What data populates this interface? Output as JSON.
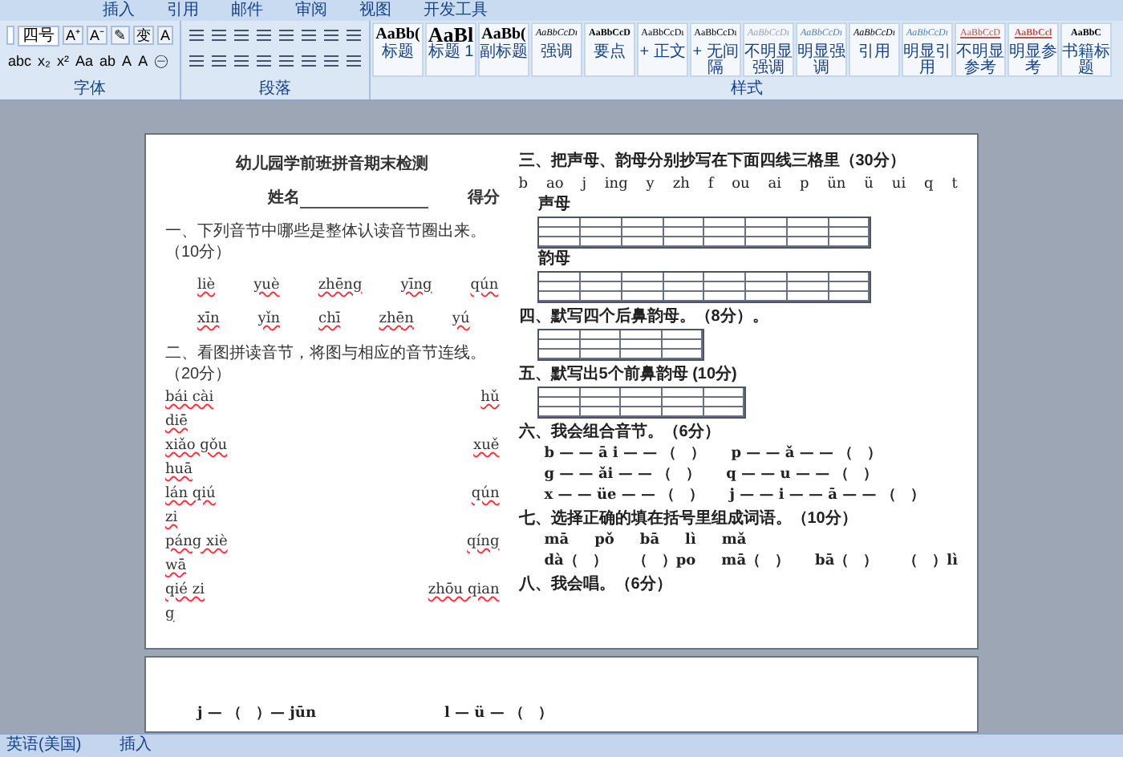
{
  "menu_tabs": [
    "插入",
    "引用",
    "邮件",
    "审阅",
    "视图",
    "开发工具"
  ],
  "ribbon": {
    "font_group": {
      "label": "字体",
      "font_size": "四号",
      "row1": [
        "A⁺",
        "A⁻",
        "✎",
        "变",
        "A"
      ],
      "row2": [
        "abc",
        "x₂",
        "x²",
        "Aa",
        "ab",
        "A",
        "A",
        "㊀"
      ]
    },
    "paragraph_group": {
      "label": "段落"
    },
    "styles_group": {
      "label": "样式",
      "styles": [
        {
          "sample": "AaBb(",
          "name": "标题",
          "kind": "heading"
        },
        {
          "sample": "AaBl",
          "name": "标题 1",
          "kind": "big"
        },
        {
          "sample": "AaBb(",
          "name": "副标题",
          "kind": "heading"
        },
        {
          "sample": "AaBbCcDı",
          "name": "强调",
          "kind": "italic"
        },
        {
          "sample": "AaBbCcD",
          "name": "要点",
          "kind": "bold"
        },
        {
          "sample": "AaBbCcDı",
          "name": "+ 正文",
          "kind": "normal"
        },
        {
          "sample": "AaBbCcDı",
          "name": "+ 无间隔",
          "kind": "normal"
        },
        {
          "sample": "AaBbCcDı",
          "name": "不明显强调",
          "kind": "faint"
        },
        {
          "sample": "AaBbCcDı",
          "name": "明显强调",
          "kind": "blue"
        },
        {
          "sample": "AaBbCcDı",
          "name": "引用",
          "kind": "italic"
        },
        {
          "sample": "AaBbCcDı",
          "name": "明显引用",
          "kind": "blue"
        },
        {
          "sample": "AaBbCcD",
          "name": "不明显参考",
          "kind": "red"
        },
        {
          "sample": "AaBbCcl",
          "name": "明显参考",
          "kind": "redbold"
        },
        {
          "sample": "AaBbC",
          "name": "书籍标题",
          "kind": "bold"
        }
      ]
    }
  },
  "page_1": {
    "title": "幼儿园学前班拼音期末检测",
    "name_label": "姓名",
    "score_label": "得分",
    "left": [
      {
        "kind": "heading",
        "text": "一、下列音节中哪些是整体认读音节圈出来。（10分）"
      },
      {
        "kind": "syllables",
        "items": [
          "liè",
          "yuè",
          "zhēng",
          "yīng",
          "qún"
        ]
      },
      {
        "kind": "syllables",
        "items": [
          "xīn",
          "yǐn",
          "chī",
          "zhēn",
          "yú"
        ]
      },
      {
        "kind": "heading",
        "text": "二、看图拼读音节，将图与相应的音节连线。（20分）"
      },
      {
        "kind": "pair",
        "left": "bái cài",
        "right": "hǔ"
      },
      {
        "kind": "pair",
        "left": "diē"
      },
      {
        "kind": "pair",
        "left": "xiǎo gǒu",
        "right": "xuě"
      },
      {
        "kind": "pair",
        "left": "huā"
      },
      {
        "kind": "pair",
        "left": "lán qiú",
        "right": "qún"
      },
      {
        "kind": "pair",
        "left": "zi"
      },
      {
        "kind": "pair",
        "left": "páng xiè",
        "right": "qíng"
      },
      {
        "kind": "pair",
        "left": "wā"
      },
      {
        "kind": "pair",
        "left": "qié zi",
        "right": "zhōu qian"
      },
      {
        "kind": "pair",
        "left": "g"
      }
    ],
    "right": [
      {
        "kind": "heading",
        "text": "三、把声母、韵母分别抄写在下面四线三格里（30分）"
      },
      {
        "kind": "letters",
        "items": [
          "b",
          "ao",
          "j",
          "ing",
          "y",
          "zh",
          "f",
          "ou",
          "ai",
          "p",
          "ün",
          "ü",
          "ui",
          "q",
          "t"
        ]
      },
      {
        "kind": "label",
        "text": "声母"
      },
      {
        "kind": "grid"
      },
      {
        "kind": "label",
        "text": "韵母"
      },
      {
        "kind": "grid"
      },
      {
        "kind": "heading",
        "text": "四、默写四个后鼻韵母。（8分）。"
      },
      {
        "kind": "grid"
      },
      {
        "kind": "heading",
        "text": "五、默写出5个前鼻韵母 (10分)"
      },
      {
        "kind": "grid"
      },
      {
        "kind": "heading",
        "text": "六、我会组合音节。（6分）"
      },
      {
        "kind": "combine",
        "items": [
          "b — — ā i — — （　）",
          "p — — ǎ — — （　）"
        ]
      },
      {
        "kind": "combine",
        "items": [
          "g — — ǎi — — （　）",
          "q — — u — — （　）"
        ]
      },
      {
        "kind": "combine",
        "items": [
          "x — — üe — — （　）",
          "j — — i — — ā — — （　）"
        ]
      },
      {
        "kind": "heading",
        "text": "七、选择正确的填在括号里组成词语。（10分）"
      },
      {
        "kind": "combine",
        "items": [
          "mā",
          "pǒ",
          "bā",
          "lì",
          "mǎ"
        ]
      },
      {
        "kind": "combine",
        "items": [
          "dà（　）",
          "（　）po",
          "mā（　）",
          "bā（　）",
          "（　）lì"
        ]
      },
      {
        "kind": "heading",
        "text": "八、我会唱。（6分）"
      }
    ]
  },
  "page_2": {
    "lines": [
      "j — （　）— jūn",
      "l — ü — （　）"
    ]
  },
  "status_bar": {
    "language": "英语(美国)",
    "mode": "插入"
  }
}
